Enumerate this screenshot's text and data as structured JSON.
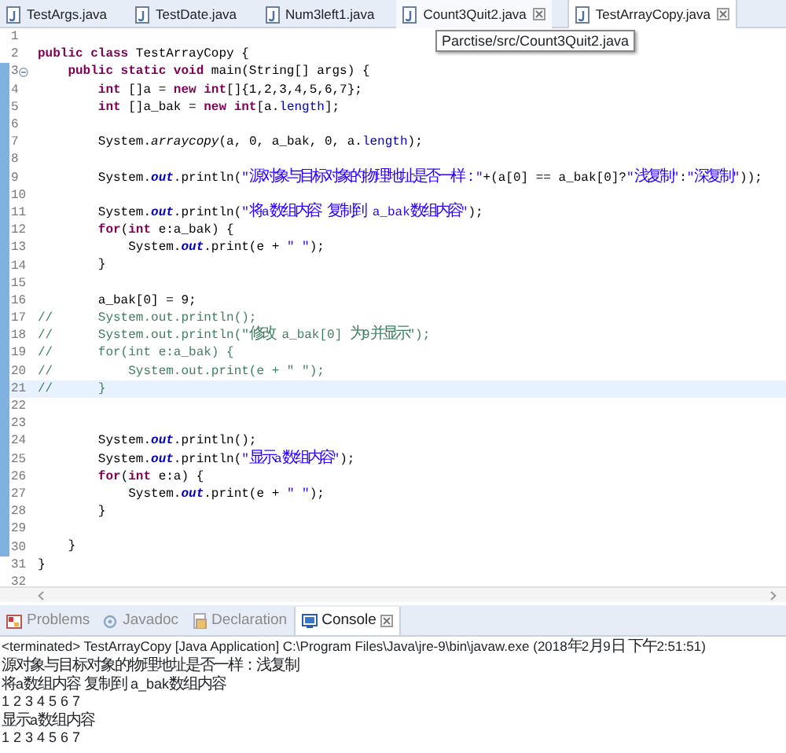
{
  "editor_tabs": [
    {
      "label": "TestArgs.java",
      "selected": false,
      "hovered": false,
      "closable": false
    },
    {
      "label": "TestDate.java",
      "selected": false,
      "hovered": false,
      "closable": false
    },
    {
      "label": "Num3left1.java",
      "selected": false,
      "hovered": false,
      "closable": false
    },
    {
      "label": "Count3Quit2.java",
      "selected": false,
      "hovered": true,
      "closable": true
    },
    {
      "label": "TestArrayCopy.java",
      "selected": true,
      "hovered": false,
      "closable": true
    }
  ],
  "tooltip": "Parctise/src/Count3Quit2.java",
  "code_lines": [
    {
      "number": "1",
      "ruler": false
    },
    {
      "number": "2",
      "ruler": false,
      "tokens": [
        {
          "kind": "kw",
          "text": "public class"
        },
        {
          "kind": "plain",
          "text": " TestArrayCopy {"
        }
      ]
    },
    {
      "number": "3",
      "ruler": true,
      "folded": false,
      "tokens": [
        {
          "kind": "kw",
          "text": "    public static void"
        },
        {
          "kind": "plain",
          "text": " main(String[] args) {"
        }
      ]
    },
    {
      "number": "4",
      "ruler": true,
      "tokens": [
        {
          "kind": "kw",
          "text": "        int"
        },
        {
          "kind": "plain",
          "text": " []a = "
        },
        {
          "kind": "kw",
          "text": "new int"
        },
        {
          "kind": "plain",
          "text": "[]{1,2,3,4,5,6,7};"
        }
      ]
    },
    {
      "number": "5",
      "ruler": true,
      "tokens": [
        {
          "kind": "kw",
          "text": "        int"
        },
        {
          "kind": "plain",
          "text": " []a_bak = "
        },
        {
          "kind": "kw",
          "text": "new int"
        },
        {
          "kind": "plain",
          "text": "[a."
        },
        {
          "kind": "member",
          "text": "length"
        },
        {
          "kind": "plain",
          "text": "];"
        }
      ]
    },
    {
      "number": "6",
      "ruler": true
    },
    {
      "number": "7",
      "ruler": true,
      "tokens": [
        {
          "kind": "plain",
          "text": "        System."
        },
        {
          "kind": "method",
          "text": "arraycopy"
        },
        {
          "kind": "plain",
          "text": "(a, 0, a_bak, 0, a."
        },
        {
          "kind": "member",
          "text": "length"
        },
        {
          "kind": "plain",
          "text": ");"
        }
      ]
    },
    {
      "number": "8",
      "ruler": true
    },
    {
      "number": "9",
      "ruler": true,
      "tokens": [
        {
          "kind": "plain",
          "text": "        System."
        },
        {
          "kind": "field",
          "text": "out"
        },
        {
          "kind": "plain",
          "text": ".println("
        },
        {
          "kind": "string",
          "text": "\"源对象与目标对象的物理地址是否一样：\""
        },
        {
          "kind": "plain",
          "text": "+(a[0] == a_bak[0]?"
        },
        {
          "kind": "string",
          "text": "\"浅复制\""
        },
        {
          "kind": "plain",
          "text": ":"
        },
        {
          "kind": "string",
          "text": "\"深复制\""
        },
        {
          "kind": "plain",
          "text": "));"
        }
      ]
    },
    {
      "number": "10",
      "ruler": true
    },
    {
      "number": "11",
      "ruler": true,
      "tokens": [
        {
          "kind": "plain",
          "text": "        System."
        },
        {
          "kind": "field",
          "text": "out"
        },
        {
          "kind": "plain",
          "text": ".println("
        },
        {
          "kind": "string",
          "text": "\"将a数组内容 复制到 a_bak数组内容\""
        },
        {
          "kind": "plain",
          "text": ");"
        }
      ]
    },
    {
      "number": "12",
      "ruler": true,
      "tokens": [
        {
          "kind": "kw",
          "text": "        for"
        },
        {
          "kind": "plain",
          "text": "("
        },
        {
          "kind": "kw",
          "text": "int"
        },
        {
          "kind": "plain",
          "text": " e:a_bak) {"
        }
      ]
    },
    {
      "number": "13",
      "ruler": true,
      "tokens": [
        {
          "kind": "plain",
          "text": "            System."
        },
        {
          "kind": "field",
          "text": "out"
        },
        {
          "kind": "plain",
          "text": ".print(e + "
        },
        {
          "kind": "string",
          "text": "\" \""
        },
        {
          "kind": "plain",
          "text": ");"
        }
      ]
    },
    {
      "number": "14",
      "ruler": true,
      "tokens": [
        {
          "kind": "plain",
          "text": "        }"
        }
      ]
    },
    {
      "number": "15",
      "ruler": true
    },
    {
      "number": "16",
      "ruler": true,
      "tokens": [
        {
          "kind": "plain",
          "text": "        a_bak[0] = 9;"
        }
      ]
    },
    {
      "number": "17",
      "ruler": true,
      "tokens": [
        {
          "kind": "comment",
          "text": "//      System.out.println();"
        }
      ]
    },
    {
      "number": "18",
      "ruler": true,
      "tokens": [
        {
          "kind": "comment",
          "text": "//      System.out.println(\"修改 a_bak[0] 为9并显示\");"
        }
      ]
    },
    {
      "number": "19",
      "ruler": true,
      "tokens": [
        {
          "kind": "comment",
          "text": "//      for(int e:a_bak) {"
        }
      ]
    },
    {
      "number": "20",
      "ruler": true,
      "tokens": [
        {
          "kind": "comment",
          "text": "//          System.out.print(e + \" \");"
        }
      ]
    },
    {
      "number": "21",
      "ruler": true,
      "current": true,
      "tokens": [
        {
          "kind": "comment",
          "text": "//      }"
        }
      ]
    },
    {
      "number": "22",
      "ruler": true
    },
    {
      "number": "23",
      "ruler": true
    },
    {
      "number": "24",
      "ruler": true,
      "tokens": [
        {
          "kind": "plain",
          "text": "        System."
        },
        {
          "kind": "field",
          "text": "out"
        },
        {
          "kind": "plain",
          "text": ".println();"
        }
      ]
    },
    {
      "number": "25",
      "ruler": true,
      "tokens": [
        {
          "kind": "plain",
          "text": "        System."
        },
        {
          "kind": "field",
          "text": "out"
        },
        {
          "kind": "plain",
          "text": ".println("
        },
        {
          "kind": "string",
          "text": "\"显示a数组内容\""
        },
        {
          "kind": "plain",
          "text": ");"
        }
      ]
    },
    {
      "number": "26",
      "ruler": true,
      "tokens": [
        {
          "kind": "kw",
          "text": "        for"
        },
        {
          "kind": "plain",
          "text": "("
        },
        {
          "kind": "kw",
          "text": "int"
        },
        {
          "kind": "plain",
          "text": " e:a) {"
        }
      ]
    },
    {
      "number": "27",
      "ruler": true,
      "tokens": [
        {
          "kind": "plain",
          "text": "            System."
        },
        {
          "kind": "field",
          "text": "out"
        },
        {
          "kind": "plain",
          "text": ".print(e + "
        },
        {
          "kind": "string",
          "text": "\" \""
        },
        {
          "kind": "plain",
          "text": ");"
        }
      ]
    },
    {
      "number": "28",
      "ruler": true,
      "tokens": [
        {
          "kind": "plain",
          "text": "        }"
        }
      ]
    },
    {
      "number": "29",
      "ruler": true
    },
    {
      "number": "30",
      "ruler": true,
      "tokens": [
        {
          "kind": "plain",
          "text": "    }"
        }
      ]
    },
    {
      "number": "31",
      "ruler": false,
      "tokens": [
        {
          "kind": "plain",
          "text": "}"
        }
      ]
    },
    {
      "number": "32",
      "ruler": false
    }
  ],
  "view_tabs": [
    {
      "label": "Problems",
      "selected": false,
      "closable": false
    },
    {
      "label": "Javadoc",
      "selected": false,
      "closable": false
    },
    {
      "label": "Declaration",
      "selected": false,
      "closable": false
    },
    {
      "label": "Console",
      "selected": true,
      "closable": true
    }
  ],
  "console": {
    "header": "<terminated> TestArrayCopy [Java Application] C:\\Program Files\\Java\\jre-9\\bin\\javaw.exe (2018年2月9日 下午2:51:51)",
    "output": [
      "源对象与目标对象的物理地址是否一样：浅复制",
      "将a数组内容 复制到 a_bak数组内容",
      "1 2 3 4 5 6 7 ",
      "显示a数组内容",
      "1 2 3 4 5 6 7 "
    ]
  }
}
